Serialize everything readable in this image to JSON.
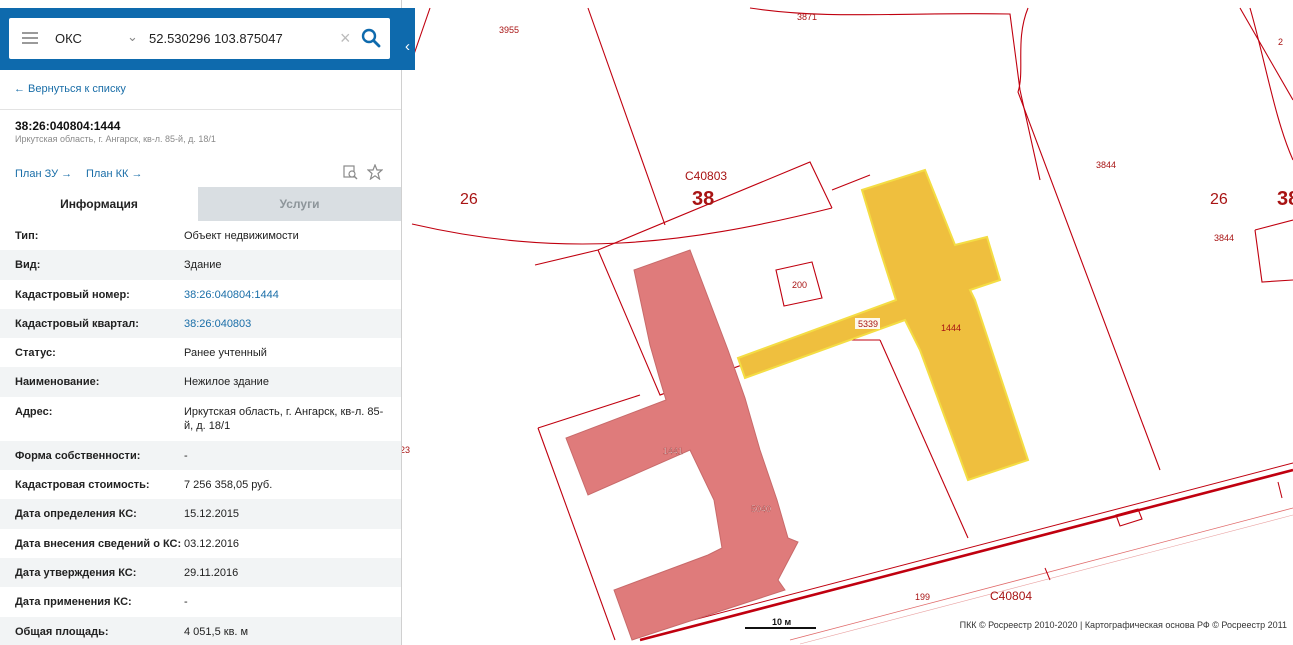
{
  "search": {
    "object_type": "ОКС",
    "query": "52.530296 103.875047"
  },
  "back_link": "← Вернуться к списку",
  "object": {
    "cad_number": "38:26:040804:1444",
    "address": "Иркутская область, г. Ангарск, кв-л. 85-й, д. 18/1"
  },
  "plan_links": {
    "plan_zu": "План ЗУ →",
    "plan_kk": "План КК →"
  },
  "tabs": {
    "info": "Информация",
    "services": "Услуги"
  },
  "attributes": [
    {
      "key": "Тип:",
      "value": "Объект недвижимости"
    },
    {
      "key": "Вид:",
      "value": "Здание"
    },
    {
      "key": "Кадастровый номер:",
      "value": "38:26:040804:1444"
    },
    {
      "key": "Кадастровый квартал:",
      "value": "38:26:040803"
    },
    {
      "key": "Статус:",
      "value": "Ранее учтенный"
    },
    {
      "key": "Наименование:",
      "value": "Нежилое здание"
    },
    {
      "key": "Адрес:",
      "value": "Иркутская область, г. Ангарск, кв-л. 85-й, д. 18/1"
    },
    {
      "key": "Форма собственности:",
      "value": "-"
    },
    {
      "key": "Кадастровая стоимость:",
      "value": "7 256 358,05 руб."
    },
    {
      "key": "Дата определения КС:",
      "value": "15.12.2015"
    },
    {
      "key": "Дата внесения сведений о КС:",
      "value": "03.12.2016"
    },
    {
      "key": "Дата утверждения КС:",
      "value": "29.11.2016"
    },
    {
      "key": "Дата применения КС:",
      "value": "-"
    },
    {
      "key": "Общая площадь:",
      "value": "4 051,5 кв. м"
    }
  ],
  "map": {
    "labels": {
      "parcel_3955": "3955",
      "parcel_3871": "3871",
      "parcel_2": "2",
      "district_26_left": "26",
      "block_c40803": "С40803",
      "region_38": "38",
      "parcel_3844_a": "3844",
      "parcel_3844_b": "3844",
      "district_26_right": "26",
      "region_38_right": "38",
      "parcel_200": "200",
      "parcel_5339": "5339",
      "building_1444": "1444",
      "building_1441": "1441",
      "parcel_5040": "5040",
      "parcel_23": "23",
      "parcel_199": "199",
      "block_c40804": "С40804"
    },
    "scale_label": "10 м",
    "copyright": "ПКК © Росреестр 2010-2020 | Картографическая основа РФ © Росреестр 2011",
    "colors": {
      "boundary": "#c0000f",
      "selected_building": "#efbf3e",
      "other_building": "#df7b7b",
      "label": "#a81414",
      "header": "#0e6aad"
    }
  }
}
